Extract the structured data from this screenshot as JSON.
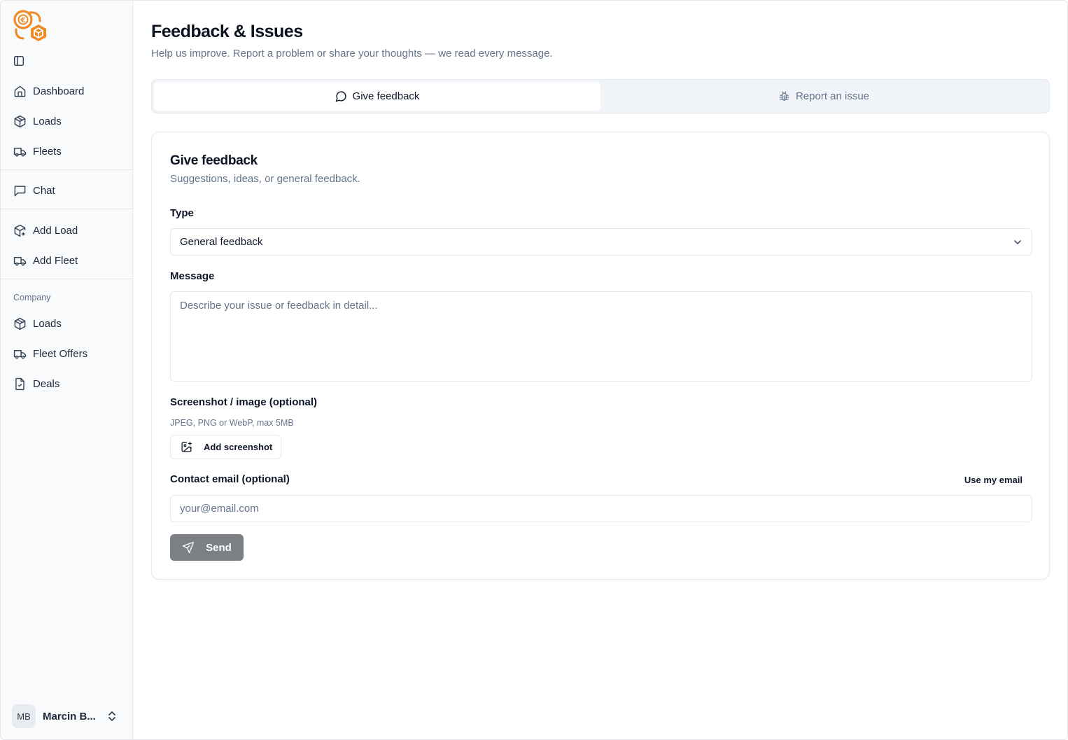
{
  "sidebar": {
    "collapse_icon": "panel-left-icon",
    "groups": [
      {
        "items": [
          {
            "label": "Dashboard",
            "icon": "home-icon"
          },
          {
            "label": "Loads",
            "icon": "package-icon"
          },
          {
            "label": "Fleets",
            "icon": "truck-icon"
          }
        ]
      },
      {
        "items": [
          {
            "label": "Chat",
            "icon": "message-square-icon"
          }
        ]
      },
      {
        "items": [
          {
            "label": "Add Load",
            "icon": "package-plus-icon"
          },
          {
            "label": "Add Fleet",
            "icon": "truck-icon"
          }
        ]
      },
      {
        "section_label": "Company",
        "items": [
          {
            "label": "Loads",
            "icon": "package-icon"
          },
          {
            "label": "Fleet Offers",
            "icon": "truck-icon"
          },
          {
            "label": "Deals",
            "icon": "file-check-icon"
          }
        ]
      }
    ],
    "user": {
      "initials": "MB",
      "name": "Marcin B..."
    }
  },
  "header": {
    "title": "Feedback & Issues",
    "subtitle": "Help us improve. Report a problem or share your thoughts — we read every message."
  },
  "tabs": [
    {
      "label": "Give feedback",
      "icon": "message-circle-icon",
      "active": true
    },
    {
      "label": "Report an issue",
      "icon": "bug-icon",
      "active": false
    }
  ],
  "form": {
    "title": "Give feedback",
    "subtitle": "Suggestions, ideas, or general feedback.",
    "type_label": "Type",
    "type_value": "General feedback",
    "message_label": "Message",
    "message_placeholder": "Describe your issue or feedback in detail...",
    "screenshot_label": "Screenshot / image (optional)",
    "screenshot_hint": "JPEG, PNG or WebP, max 5MB",
    "add_screenshot_label": "Add screenshot",
    "email_label": "Contact email (optional)",
    "use_my_email_label": "Use my email",
    "email_placeholder": "your@email.com",
    "send_label": "Send"
  },
  "colors": {
    "brand_orange": "#f08a24",
    "send_disabled": "#7c7f84",
    "sidebar_bg": "#f8fafc"
  }
}
